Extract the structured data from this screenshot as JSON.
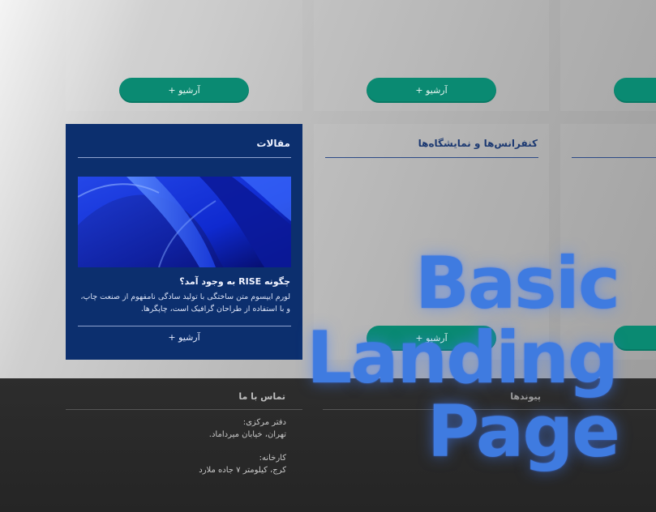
{
  "archive_label": "+ آرشیو",
  "articles": {
    "title": "مقالات",
    "headline": "چگونه RISE به وجود آمد؟",
    "body": "لورم ایپسوم متن ساختگی با تولید سادگی نامفهوم از صنعت چاپ، و با استفاده از طراحان گرافیک است، چاپگرها."
  },
  "conferences": {
    "title": "کنفرانس‌ها و نمایشگاه‌ها"
  },
  "footer": {
    "contact_title": "تماس با ما",
    "office_label": "دفتر مرکزی:",
    "office_address": "تهران، خیابان میرداماد.",
    "factory_label": "کارخانه:",
    "factory_address": "کرج، کیلومتر ۷ جاده ملارد",
    "links_title": "پیوندها"
  },
  "overlay": {
    "line1": "Basic",
    "line2": "Landing",
    "line3": "Page"
  },
  "colors": {
    "accent_green": "#0a8a72",
    "featured_blue": "#0c2f6e",
    "overlay_blue": "#3f7be0",
    "footer_bg": "#2a2a2a"
  }
}
